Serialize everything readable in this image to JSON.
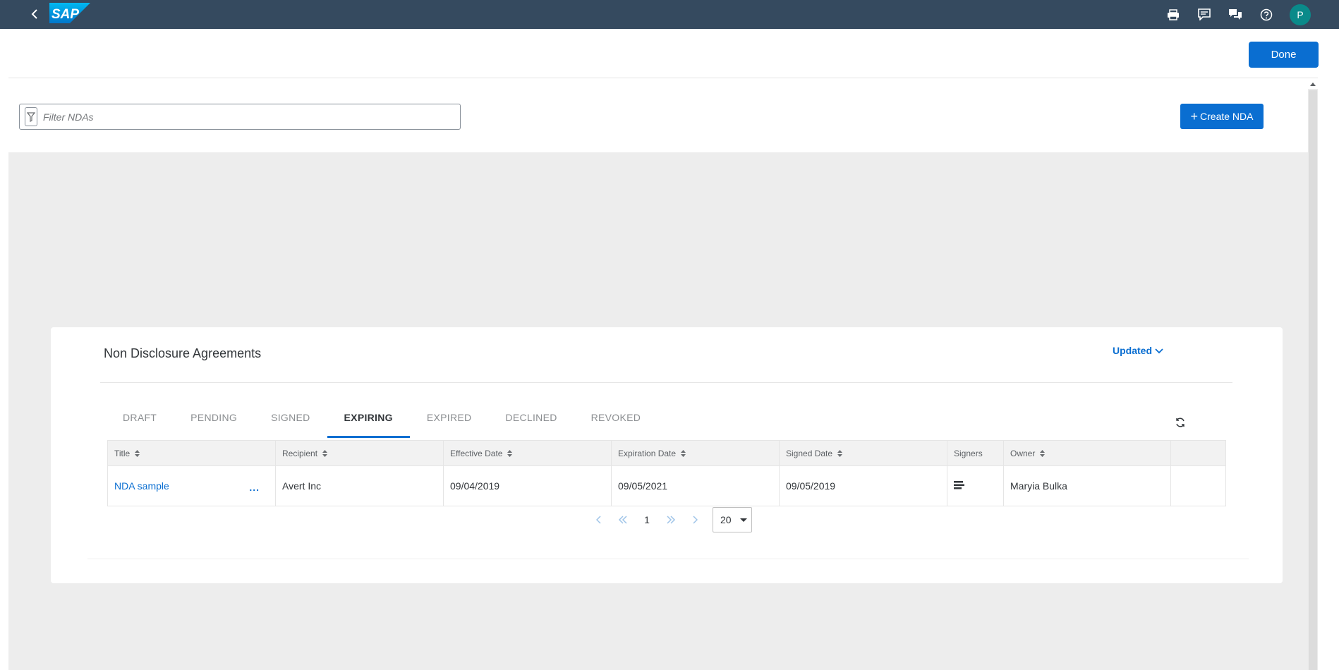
{
  "shell": {
    "logo_text": "SAP",
    "avatar_initial": "P",
    "colors": {
      "bar": "#354a5f",
      "avatar": "#0a8a8a"
    },
    "icons": [
      "back-icon",
      "print-icon",
      "feedback-icon",
      "chat-icon",
      "help-icon"
    ]
  },
  "header": {
    "done_label": "Done"
  },
  "filter": {
    "placeholder": "Filter NDAs"
  },
  "actions": {
    "create_label": "Create NDA"
  },
  "card": {
    "title": "Non Disclosure Agreements",
    "sort_label": "Updated"
  },
  "tabs": [
    {
      "label": "DRAFT",
      "active": false
    },
    {
      "label": "PENDING",
      "active": false
    },
    {
      "label": "SIGNED",
      "active": false
    },
    {
      "label": "EXPIRING",
      "active": true
    },
    {
      "label": "EXPIRED",
      "active": false
    },
    {
      "label": "DECLINED",
      "active": false
    },
    {
      "label": "REVOKED",
      "active": false
    }
  ],
  "table": {
    "columns": [
      "Title",
      "Recipient",
      "Effective Date",
      "Expiration Date",
      "Signed Date",
      "Signers",
      "Owner",
      ""
    ],
    "rows": [
      {
        "title": "NDA sample",
        "more": "...",
        "recipient": "Avert Inc",
        "effective_date": "09/04/2019",
        "expiration_date": "09/05/2021",
        "signed_date": "09/05/2019",
        "signers_icon": "signers-list-icon",
        "owner": "Maryia Bulka"
      }
    ]
  },
  "pager": {
    "current_page": "1",
    "page_size": "20"
  },
  "accent_color": "#0a6ed1"
}
